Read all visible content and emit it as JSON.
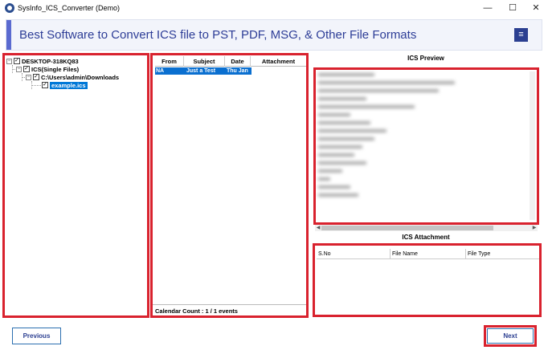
{
  "window": {
    "title": "SysInfo_ICS_Converter (Demo)",
    "minimize_glyph": "—",
    "maximize_glyph": "☐",
    "close_glyph": "✕"
  },
  "header": {
    "title": "Best Software to Convert ICS file to PST, PDF, MSG, & Other File Formats",
    "menu_icon": "hamburger-menu-icon",
    "menu_glyph": "≡"
  },
  "tree": {
    "nodes": [
      {
        "label": "DESKTOP-318KQ83",
        "expander": "−",
        "checked": true
      },
      {
        "label": "ICS(Single Files)",
        "expander": "−",
        "checked": true
      },
      {
        "label": "C:\\Users\\admin\\Downloads",
        "expander": "−",
        "checked": true
      },
      {
        "label": "example.ics",
        "checked": true,
        "selected": true
      }
    ]
  },
  "event_list": {
    "columns": [
      "From",
      "Subject",
      "Date",
      "Attachment"
    ],
    "rows": [
      {
        "from": "NA",
        "subject": "Just a Test",
        "date": "Thu Jan",
        "attachment": ""
      }
    ],
    "footer": "Calendar Count : 1 / 1 events"
  },
  "preview": {
    "label": "ICS Preview"
  },
  "attachment": {
    "label": "ICS Attachment",
    "columns": [
      "S.No",
      "File Name",
      "File Type"
    ]
  },
  "buttons": {
    "previous": "Previous",
    "next": "Next"
  },
  "colors": {
    "highlight_border": "#d9222e",
    "brand_blue": "#2b3f91",
    "selection": "#0078d7"
  }
}
